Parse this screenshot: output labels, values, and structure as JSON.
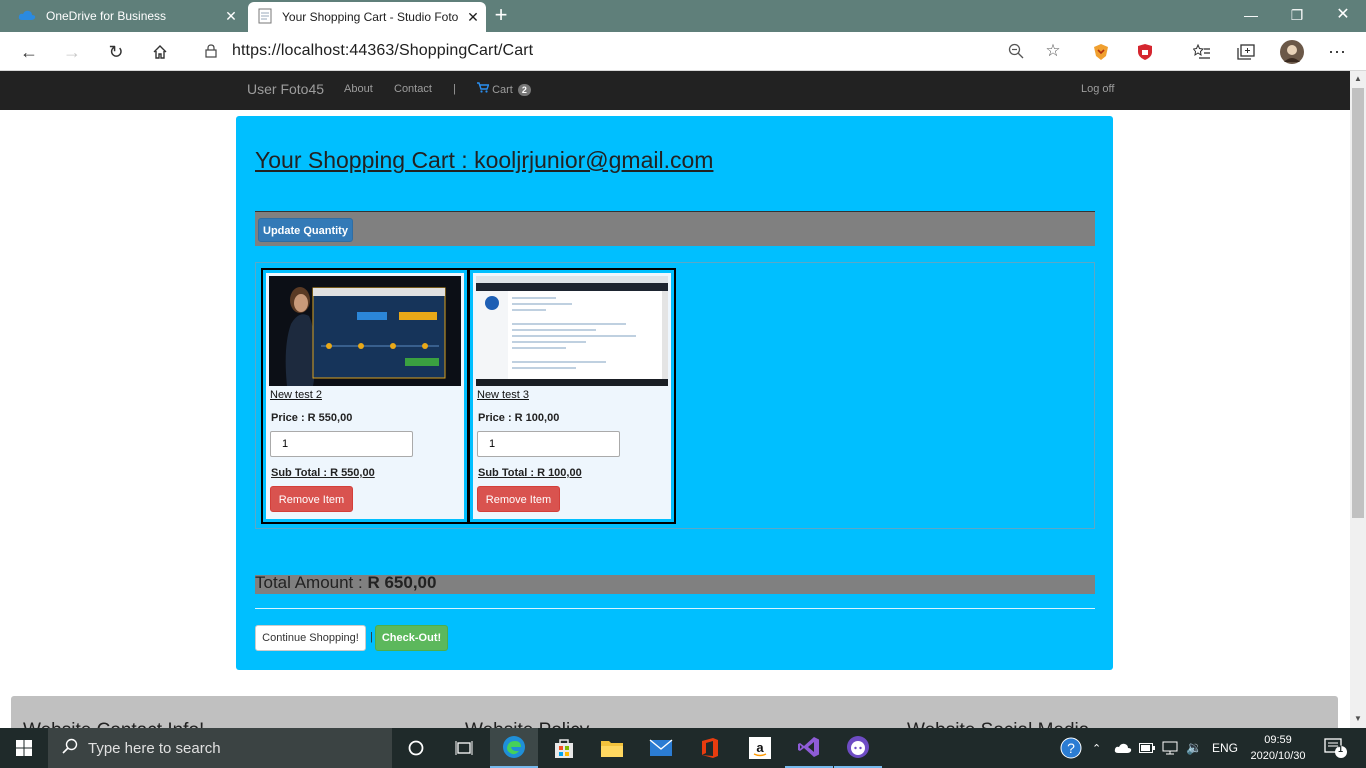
{
  "browser": {
    "tabs": [
      {
        "title": "OneDrive for Business",
        "close": "✕"
      },
      {
        "title": "Your Shopping Cart - Studio Foto",
        "close": "✕"
      }
    ],
    "new_tab": "+",
    "url": "https://localhost:44363/ShoppingCart/Cart"
  },
  "navbar": {
    "brand": "User Foto45",
    "about": "About",
    "contact": "Contact",
    "divider": "|",
    "cart_label": "Cart",
    "cart_count": "2",
    "logoff": "Log off"
  },
  "cart": {
    "heading": "Your Shopping Cart : kooljrjunior@gmail.com",
    "update_label": "Update Quantity",
    "items": [
      {
        "name": "New test 2",
        "price": "Price : R 550,00",
        "quantity": "1",
        "subtotal": "Sub Total : R 550,00",
        "remove_label": "Remove Item"
      },
      {
        "name": "New test 3",
        "price": "Price : R 100,00",
        "quantity": "1",
        "subtotal": "Sub Total : R 100,00",
        "remove_label": "Remove Item"
      }
    ],
    "total_label": "Total Amount :",
    "total_value": "R 650,00",
    "continue_label": "Continue Shopping!",
    "separator": "|",
    "checkout_label": "Check-Out!"
  },
  "footer": {
    "contact_heading": "Website Contact Info!",
    "policy_heading": "Website Policy",
    "social_heading": "Website Social Media"
  },
  "taskbar": {
    "search_placeholder": "Type here to search",
    "language": "ENG",
    "time": "09:59",
    "date": "2020/10/30",
    "notification_count": "1"
  },
  "colors": {
    "panel_bg": "#00bfff",
    "navbar_bg": "#222222",
    "update_btn": "#337ab7",
    "remove_btn": "#d9534f",
    "checkout_btn": "#5cb85c"
  }
}
